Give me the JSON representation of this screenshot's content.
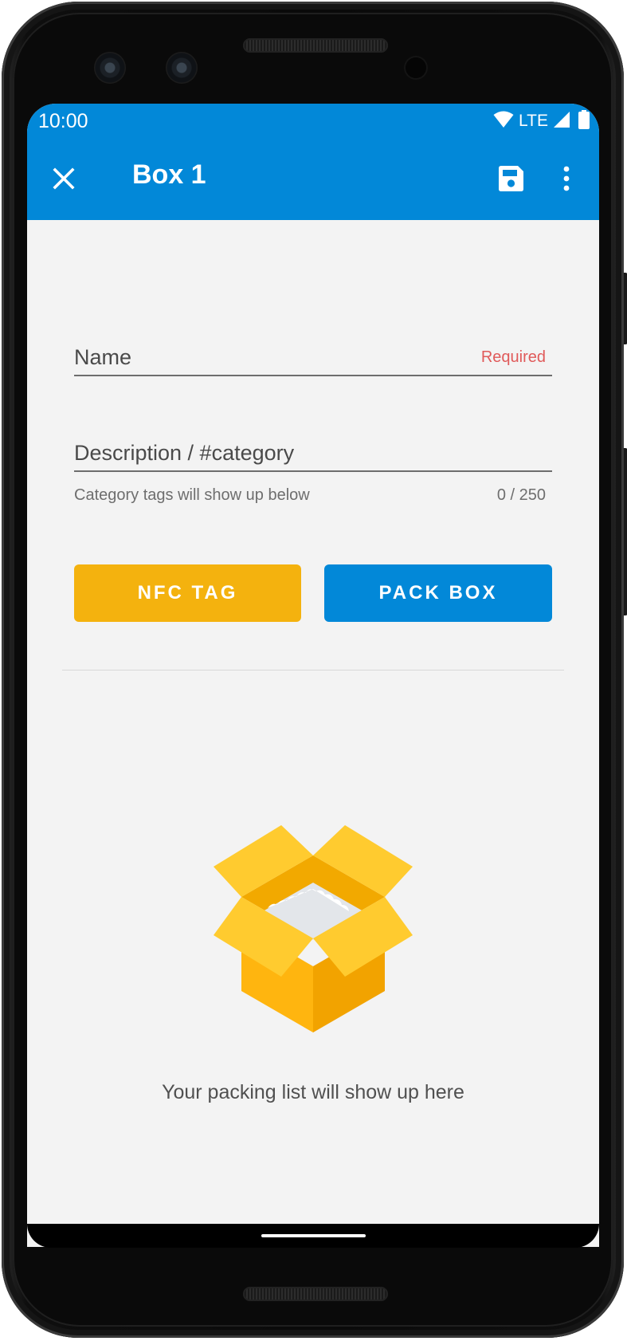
{
  "status_bar": {
    "time": "10:00",
    "network": "LTE",
    "icons": [
      "wifi-icon",
      "signal-icon",
      "battery-icon"
    ]
  },
  "app_bar": {
    "title": "Box 1",
    "close_icon": "close-icon",
    "save_icon": "save-icon",
    "more_icon": "more-vert-icon"
  },
  "form": {
    "name_field": {
      "placeholder": "Name",
      "value": "",
      "required_label": "Required"
    },
    "description_field": {
      "placeholder": "Description / #category",
      "value": "",
      "helper_text": "Category tags will show up below",
      "counter": "0 / 250"
    }
  },
  "actions": {
    "nfc_tag_label": "NFC TAG",
    "pack_box_label": "PACK BOX"
  },
  "empty_state": {
    "illustration": "open-box-icon",
    "message": "Your packing list will show up here"
  },
  "colors": {
    "primary": "#0288d8",
    "accent": "#f4b20e",
    "error": "#e05a5a",
    "background": "#f3f3f3"
  }
}
